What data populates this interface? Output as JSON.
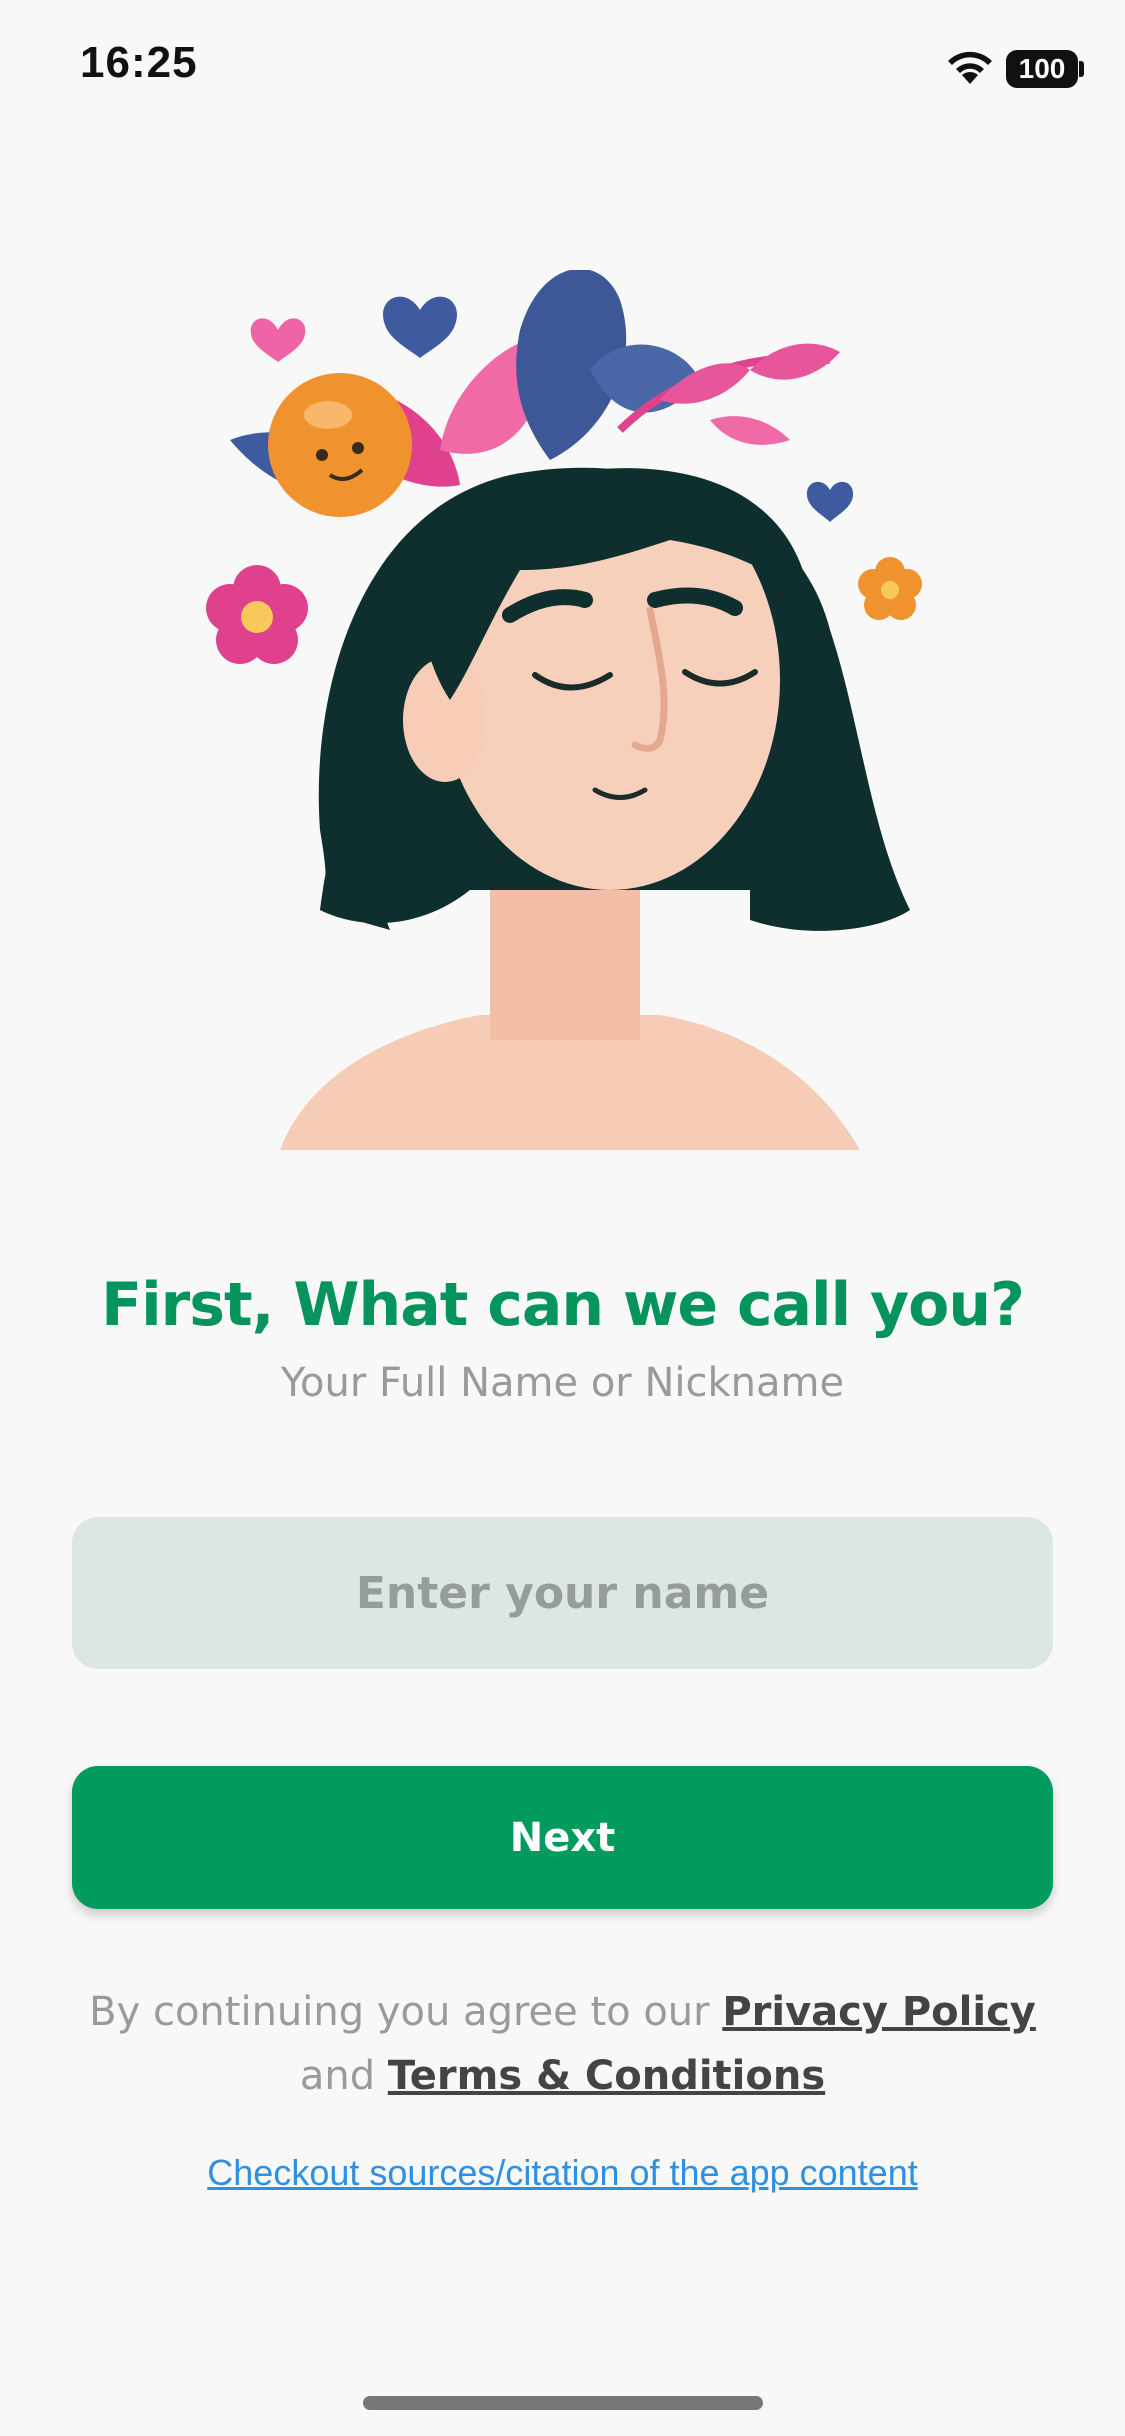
{
  "status_bar": {
    "time": "16:25",
    "battery": "100",
    "wifi_icon": "wifi-icon"
  },
  "illustration": {
    "icon": "woman-with-flowers-illustration"
  },
  "onboarding": {
    "title": "First, What can we call you?",
    "subtitle": "Your Full Name or Nickname",
    "name_placeholder": "Enter your name",
    "next_label": "Next",
    "legal_prefix": "By continuing you agree to our",
    "privacy_label": "Privacy Policy",
    "legal_and": "and",
    "terms_label": "Terms & Conditions",
    "sources_label": "Checkout sources/citation of the app content"
  },
  "colors": {
    "accent": "#019b5d",
    "heading": "#05945c",
    "input_bg": "#dce7e5",
    "link": "#2f8fe0",
    "background": "#f8f8f8"
  }
}
